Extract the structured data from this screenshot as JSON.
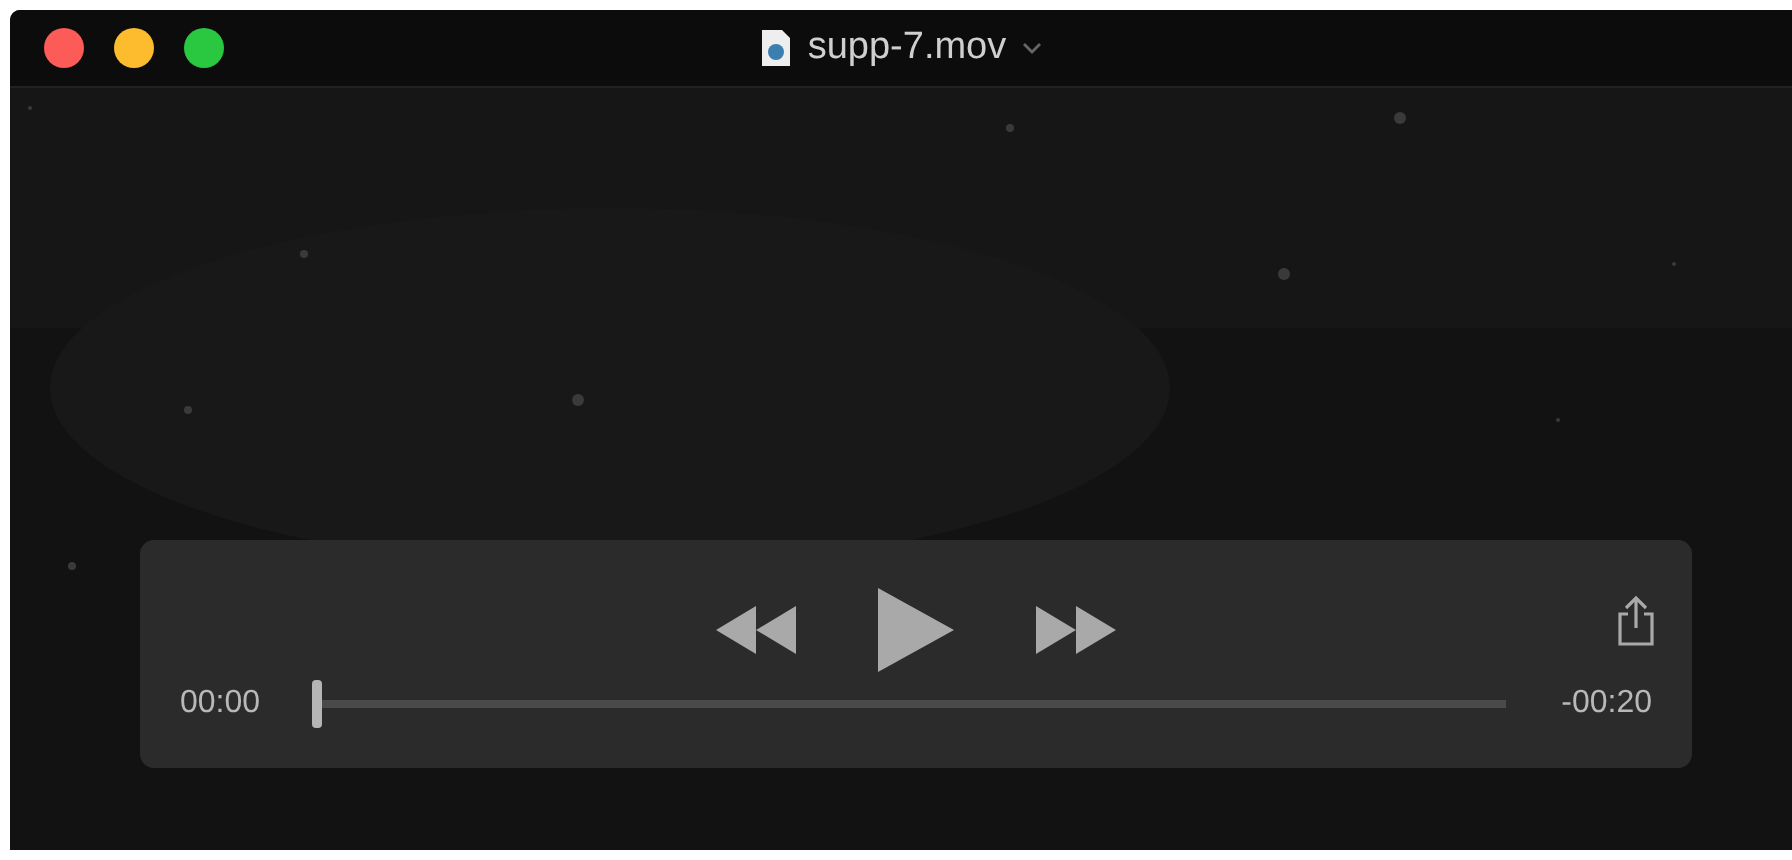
{
  "window": {
    "title": "supp-7.mov"
  },
  "controls": {
    "elapsed": "00:00",
    "remaining": "-00:20",
    "scrubber": {
      "level": 0
    }
  }
}
